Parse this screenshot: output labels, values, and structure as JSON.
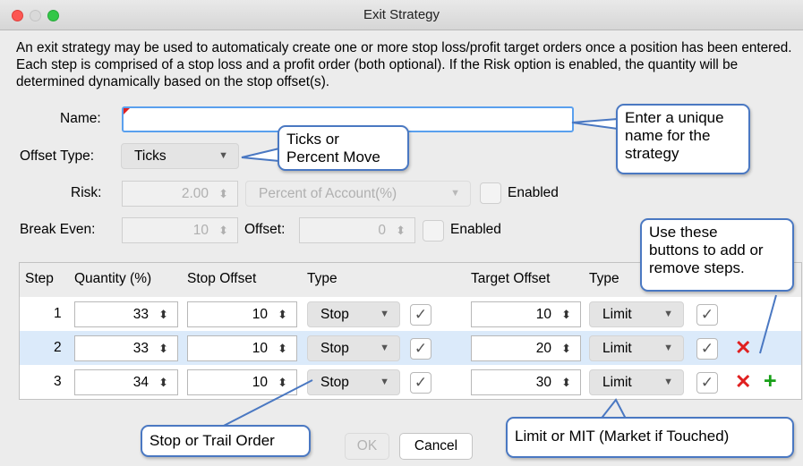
{
  "window": {
    "title": "Exit Strategy",
    "traffic_lights": [
      "close",
      "minimize",
      "maximize"
    ],
    "colors": {
      "close": "#fc5753",
      "minimize": "#d9d9d9",
      "maximize": "#33c748"
    }
  },
  "description": "An exit strategy may be used to automaticaly create one or more stop loss/profit target orders once a position has been entered.  Each step is comprised of a stop loss and a profit order (both optional). If the Risk option is enabled, the quantity will be determined dynamically based on the stop offset(s).",
  "form": {
    "name_label": "Name:",
    "name_value": "",
    "offset_type_label": "Offset Type:",
    "offset_type_value": "Ticks",
    "risk_label": "Risk:",
    "risk_value": "2.00",
    "risk_mode_value": "Percent of Account(%)",
    "risk_enabled_label": "Enabled",
    "risk_enabled_checked": false,
    "break_even_label": "Break Even:",
    "break_even_value": "10",
    "offset_label": "Offset:",
    "offset_value": "0",
    "break_even_enabled_label": "Enabled",
    "break_even_enabled_checked": false
  },
  "grid": {
    "headers": [
      "Step",
      "Quantity (%)",
      "Stop Offset",
      "Type",
      "Target Offset",
      "Type"
    ],
    "rows": [
      {
        "step": "1",
        "quantity": "33",
        "stop_offset": "10",
        "stop_type": "Stop",
        "stop_checked": true,
        "target_offset": "10",
        "target_type": "Limit",
        "target_checked": true,
        "remove": false,
        "add": false
      },
      {
        "step": "2",
        "quantity": "33",
        "stop_offset": "10",
        "stop_type": "Stop",
        "stop_checked": true,
        "target_offset": "20",
        "target_type": "Limit",
        "target_checked": true,
        "remove": true,
        "add": false
      },
      {
        "step": "3",
        "quantity": "34",
        "stop_offset": "10",
        "stop_type": "Stop",
        "stop_checked": true,
        "target_offset": "30",
        "target_type": "Limit",
        "target_checked": true,
        "remove": true,
        "add": true
      }
    ],
    "selected_row_color": "#dbeafa"
  },
  "buttons": {
    "ok": "OK",
    "cancel": "Cancel"
  },
  "callouts": {
    "name": "Enter a unique name for the strategy",
    "name_lines": [
      "Enter a unique",
      "name for the",
      "strategy"
    ],
    "ticks": "Ticks or Percent Move",
    "ticks_lines": [
      "Ticks or",
      "Percent Move"
    ],
    "steps": "Use these buttons to add or remove steps.",
    "steps_lines": [
      "Use these",
      "buttons to add or",
      "remove steps."
    ],
    "stop": "Stop or Trail Order",
    "limit": "Limit or MIT (Market if Touched)",
    "border_color": "#4a78c2"
  },
  "icons": {
    "spinner": "up-down-arrows",
    "dropdown": "chevron-down",
    "check": "checkmark",
    "remove": "red-x",
    "add": "green-plus"
  }
}
